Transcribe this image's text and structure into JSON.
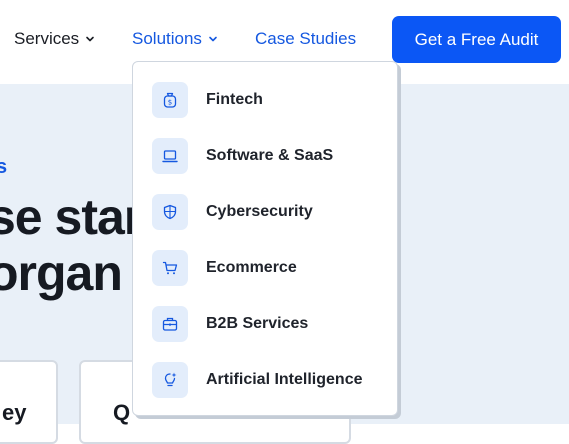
{
  "nav": {
    "services_label": "Services",
    "solutions_label": "Solutions",
    "case_studies_label": "Case Studies",
    "cta_label": "Get a Free Audit"
  },
  "hero": {
    "kicker": "s",
    "line1": "se star",
    "line2": "organ"
  },
  "cards": [
    {
      "text": "ey"
    },
    {
      "text": "Q"
    }
  ],
  "solutions_menu": {
    "items": [
      {
        "label": "Fintech",
        "icon": "money-bag-icon"
      },
      {
        "label": "Software & SaaS",
        "icon": "laptop-icon"
      },
      {
        "label": "Cybersecurity",
        "icon": "shield-icon"
      },
      {
        "label": "Ecommerce",
        "icon": "cart-icon"
      },
      {
        "label": "B2B Services",
        "icon": "briefcase-icon"
      },
      {
        "label": "Artificial Intelligence",
        "icon": "ai-bulb-icon"
      }
    ]
  },
  "colors": {
    "brand_blue": "#0b57f5",
    "link_blue": "#1558e0",
    "hero_bg": "#e9f0f8",
    "icon_tile_bg": "#e3edfb"
  }
}
